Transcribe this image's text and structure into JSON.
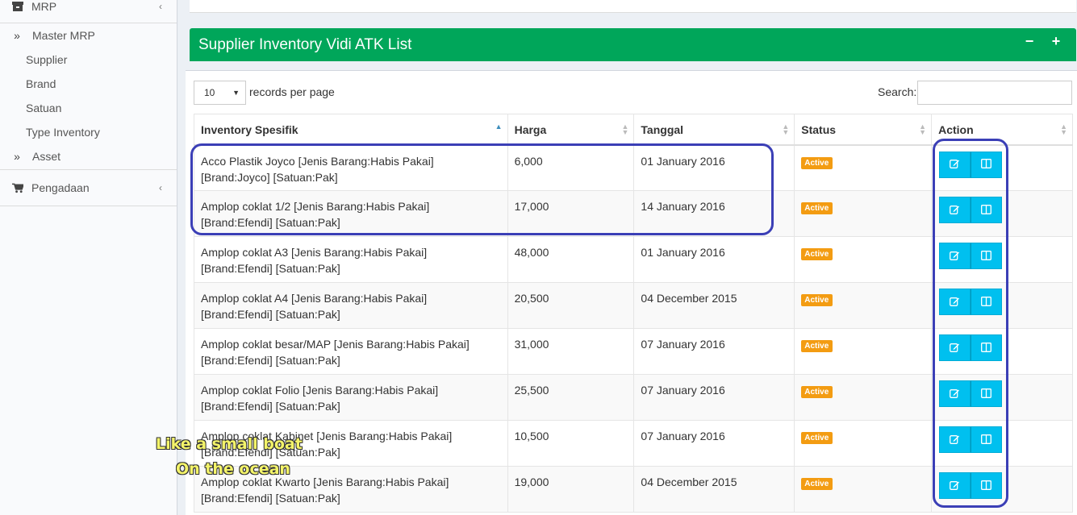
{
  "sidebar": {
    "mrp": "MRP",
    "items": [
      {
        "label": "Master MRP"
      },
      {
        "label": "Supplier"
      },
      {
        "label": "Brand"
      },
      {
        "label": "Satuan"
      },
      {
        "label": "Type Inventory"
      },
      {
        "label": "Asset"
      }
    ],
    "pengadaan": "Pengadaan"
  },
  "box": {
    "title": "Supplier Inventory Vidi ATK List",
    "collapse": "−",
    "expand": "+"
  },
  "table_controls": {
    "length_value": "10",
    "length_suffix": "records per page",
    "search_label": "Search:",
    "search_value": ""
  },
  "table": {
    "headers": [
      "Inventory Spesifik",
      "Harga",
      "Tanggal",
      "Status",
      "Action"
    ],
    "rows": [
      {
        "spesifik": "Acco Plastik Joyco [Jenis Barang:Habis Pakai] [Brand:Joyco] [Satuan:Pak]",
        "harga": "6,000",
        "tanggal": "01 January 2016",
        "status": "Active"
      },
      {
        "spesifik": "Amplop coklat 1/2 [Jenis Barang:Habis Pakai] [Brand:Efendi] [Satuan:Pak]",
        "harga": "17,000",
        "tanggal": "14 January 2016",
        "status": "Active"
      },
      {
        "spesifik": "Amplop coklat A3 [Jenis Barang:Habis Pakai] [Brand:Efendi] [Satuan:Pak]",
        "harga": "48,000",
        "tanggal": "01 January 2016",
        "status": "Active"
      },
      {
        "spesifik": "Amplop coklat A4 [Jenis Barang:Habis Pakai] [Brand:Efendi] [Satuan:Pak]",
        "harga": "20,500",
        "tanggal": "04 December 2015",
        "status": "Active"
      },
      {
        "spesifik": "Amplop coklat besar/MAP [Jenis Barang:Habis Pakai] [Brand:Efendi] [Satuan:Pak]",
        "harga": "31,000",
        "tanggal": "07 January 2016",
        "status": "Active"
      },
      {
        "spesifik": "Amplop coklat Folio [Jenis Barang:Habis Pakai] [Brand:Efendi] [Satuan:Pak]",
        "harga": "25,500",
        "tanggal": "07 January 2016",
        "status": "Active"
      },
      {
        "spesifik": "Amplop coklat Kabinet [Jenis Barang:Habis Pakai] [Brand:Efendi] [Satuan:Pak]",
        "harga": "10,500",
        "tanggal": "07 January 2016",
        "status": "Active"
      },
      {
        "spesifik": "Amplop coklat Kwarto [Jenis Barang:Habis Pakai] [Brand:Efendi] [Satuan:Pak]",
        "harga": "19,000",
        "tanggal": "04 December 2015",
        "status": "Active"
      }
    ]
  },
  "captions": [
    "Like a small boat",
    "On the ocean"
  ],
  "icons": {
    "mrp": "archive-icon",
    "submenu": "double-chevron-right-icon",
    "pengadaan": "shopping-cart-icon",
    "edit": "edit-icon",
    "detail": "columns-icon"
  },
  "colors": {
    "header_green": "#00a65a",
    "button_cyan": "#00c0ef",
    "badge_orange": "#f39c12",
    "annotation_blue": "#3b3fb6",
    "caption_yellow": "#f4f46a"
  }
}
